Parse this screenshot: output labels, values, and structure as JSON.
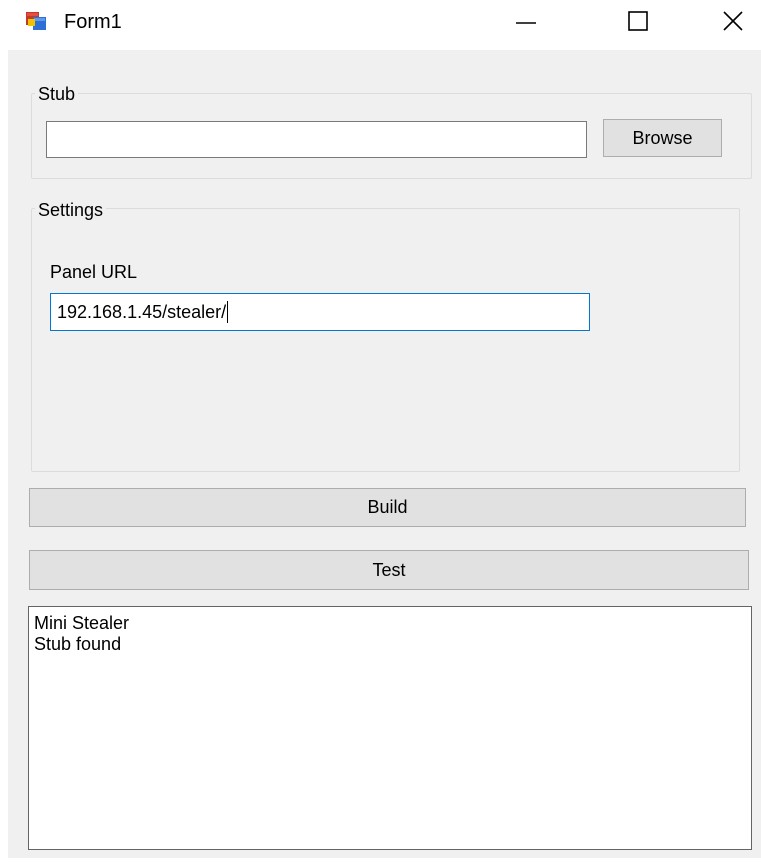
{
  "window": {
    "title": "Form1",
    "controls": {
      "minimize_icon": "minimize-icon",
      "maximize_icon": "maximize-icon",
      "close_icon": "close-icon"
    }
  },
  "stub_group": {
    "title": "Stub",
    "path_value": "",
    "browse_label": "Browse"
  },
  "settings_group": {
    "title": "Settings",
    "panel_url_label": "Panel URL",
    "panel_url_value": "192.168.1.45/stealer/"
  },
  "actions": {
    "build_label": "Build",
    "test_label": "Test"
  },
  "log": {
    "lines": [
      "Mini Stealer",
      "Stub found"
    ]
  },
  "colors": {
    "client_bg": "#f0f0f0",
    "button_bg": "#e1e1e1",
    "focus_border": "#0078d7"
  }
}
